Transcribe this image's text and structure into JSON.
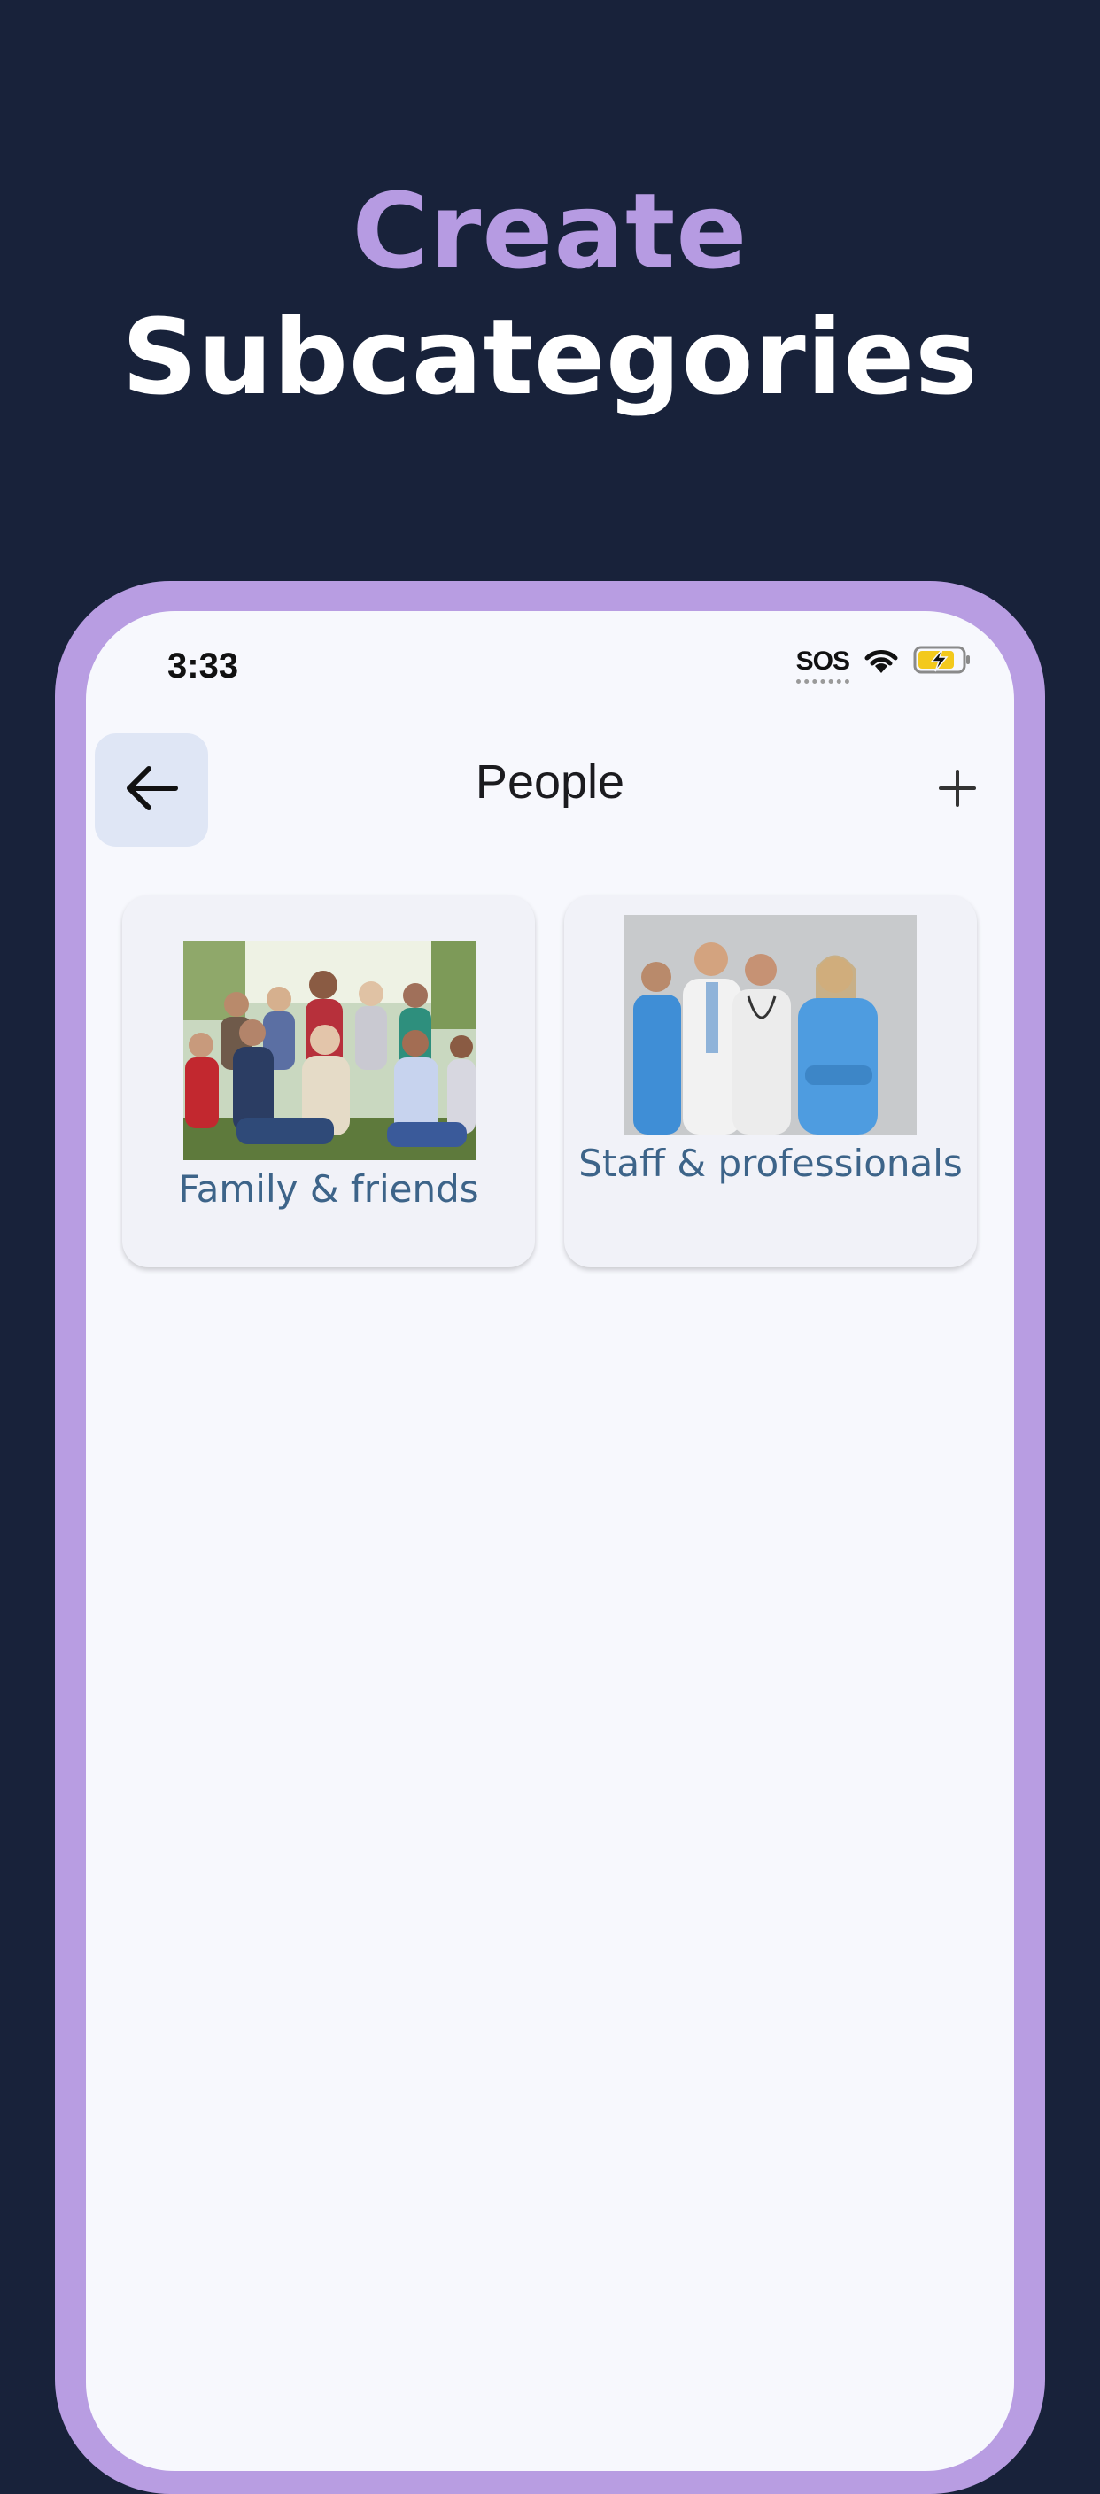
{
  "headline": {
    "line1": "Create",
    "line2": "Subcategories"
  },
  "status_bar": {
    "time": "3:33",
    "sos": "SOS",
    "icons": [
      "wifi-icon",
      "battery-charging-icon"
    ]
  },
  "nav": {
    "title": "People",
    "back_icon": "arrow-left-icon",
    "add_icon": "plus-icon"
  },
  "categories": [
    {
      "label": "Family & friends",
      "image": "group-photo-family"
    },
    {
      "label": "Staff & professionals",
      "image": "group-photo-medical-staff"
    }
  ],
  "colors": {
    "background": "#18223a",
    "accent": "#b69be2",
    "frame": "#b89de2",
    "screen": "#f7f8fd",
    "label": "#3d6489",
    "back_button_bg": "#dfe6f5"
  }
}
